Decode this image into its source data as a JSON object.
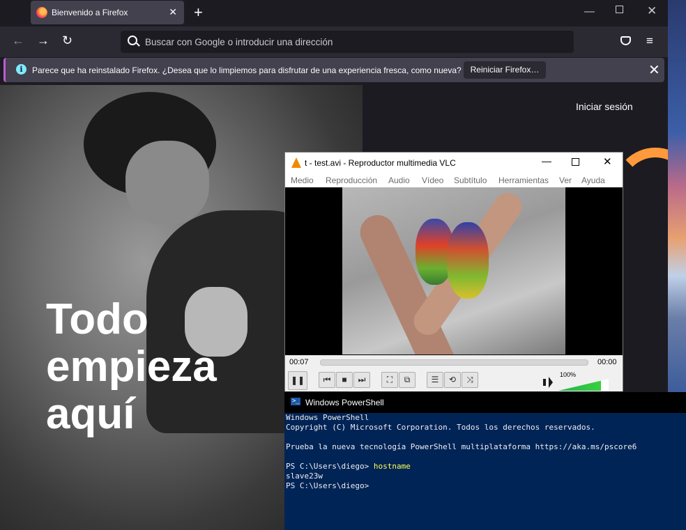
{
  "firefox": {
    "tab": {
      "title": "Bienvenido a Firefox",
      "close": "✕"
    },
    "new_tab": "+",
    "window_controls": {
      "minimize": "—",
      "close": "✕"
    },
    "nav": {
      "back": "←",
      "forward": "→",
      "reload": "↻",
      "menu": "≡"
    },
    "urlbar": {
      "placeholder": "Buscar con Google o introducir una dirección"
    },
    "infobar": {
      "icon": "i",
      "text": "Parece que ha reinstalado Firefox. ¿Desea que lo limpiemos para disfrutar de una experiencia fresca, como nueva?",
      "button": "Reiniciar Firefox…",
      "close": "✕"
    },
    "page": {
      "signin": "Iniciar sesión",
      "hero_title": [
        "Todo",
        "empieza",
        "aquí"
      ]
    }
  },
  "vlc": {
    "title": "t - test.avi - Reproductor multimedia VLC",
    "window_controls": {
      "minimize": "—",
      "close": "✕"
    },
    "menu": [
      "Medio",
      "Reproducción",
      "Audio",
      "Vídeo",
      "Subtítulo",
      "Herramientas",
      "Ver",
      "Ayuda"
    ],
    "time_elapsed": "00:07",
    "time_total": "00:00",
    "seek_fraction": 0.0,
    "controls": {
      "pause": "❚❚",
      "prev": "⏮",
      "stop": "■",
      "next": "⏭",
      "fullscreen": "⛶",
      "extended": "⧉",
      "playlist": "☰",
      "loop": "⟲",
      "shuffle": "⤨"
    },
    "volume_label": "100%",
    "volume_fraction": 0.85
  },
  "powershell": {
    "title": "Windows PowerShell",
    "lines": [
      {
        "text": "Windows PowerShell",
        "cmd": ""
      },
      {
        "text": "Copyright (C) Microsoft Corporation. Todos los derechos reservados.",
        "cmd": ""
      },
      {
        "text": "",
        "cmd": ""
      },
      {
        "text": "Prueba la nueva tecnología PowerShell multiplataforma https://aka.ms/pscore6",
        "cmd": ""
      },
      {
        "text": "",
        "cmd": ""
      },
      {
        "text": "PS C:\\Users\\diego> ",
        "cmd": "hostname"
      },
      {
        "text": "slave23w",
        "cmd": ""
      },
      {
        "text": "PS C:\\Users\\diego> ",
        "cmd": ""
      }
    ]
  },
  "colors": {
    "firefox_bg": "#1c1b22",
    "firefox_toolbar": "#2b2a33",
    "infobar_accent": "#c05ad8",
    "vlc_orange": "#f08a00",
    "vlc_volume": "#22b44c",
    "powershell_bg": "#012456",
    "powershell_cmd": "#fefe54",
    "hero_orange": "#ff9a3c"
  },
  "icons": {
    "firefox_tab": "firefox-logo-icon",
    "url_search": "search-icon",
    "pocket": "pocket-icon",
    "info": "info-icon",
    "vlc": "vlc-cone-icon",
    "powershell": "powershell-icon",
    "volume": "speaker-icon"
  }
}
